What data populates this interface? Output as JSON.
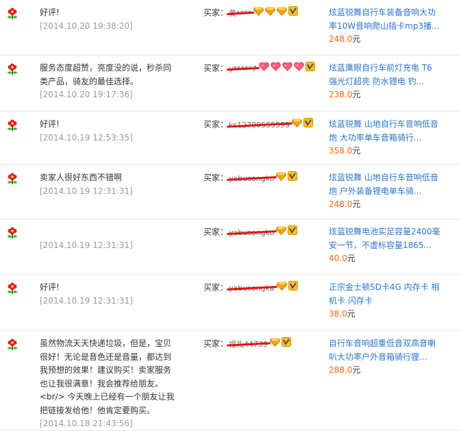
{
  "labels": {
    "buyer": "买家：",
    "currency": "元"
  },
  "reviews": [
    {
      "comment_lines": [
        "好评!"
      ],
      "time": "[2014.10.20 19:38:20]",
      "buyer_name": "黄****",
      "badges": [
        "diamond",
        "diamond",
        "diamond",
        "vip"
      ],
      "product_lines": [
        "炫蓝锐舞自行车装备音响大功",
        "率10W音响爬山插卡mp3播..."
      ],
      "price": "248.0"
    },
    {
      "comment_lines": [
        "服务态度超赞，亮度没的说，秒杀同",
        "类产品，骑友的最佳选择。"
      ],
      "time": "[2014.10.20 19:17:36]",
      "buyer_name": "y*****7",
      "badges": [
        "heart",
        "heart",
        "heart",
        "heart",
        "vip"
      ],
      "product_lines": [
        "炫蓝鹰眼自行车前灯充电 T6",
        "强光灯超亮 防水锂电 钓..."
      ],
      "price": "238.0"
    },
    {
      "comment_lines": [
        "好评!"
      ],
      "time": "[2014.10.19 12:53:35]",
      "buyer_name": "ks12700555599",
      "badges": [
        "diamond",
        "vip"
      ],
      "product_lines": [
        "炫蓝锐舞 山地自行车音响低音",
        "炮 大功率单车音箱骑行..."
      ],
      "price": "358.0"
    },
    {
      "comment_lines": [
        "卖家人很好东西不错啊"
      ],
      "time": "[2014.10.19 12:31:31]",
      "buyer_name": "yabusongko",
      "badges": [
        "diamond",
        "vip"
      ],
      "product_lines": [
        "炫蓝锐舞 山地自行车音响低音",
        "炮 户外装备锂电单车骑..."
      ],
      "price": "248.0"
    },
    {
      "comment_lines": [],
      "time": "[2014.10.19 12:31:31]",
      "buyer_name": "yabusongko",
      "badges": [
        "diamond",
        "vip"
      ],
      "product_lines": [
        "炫蓝锐舞电池实足容量2400毫",
        "安一节，不虚标容量1865..."
      ],
      "price": "40.0"
    },
    {
      "comment_lines": [
        "好评!"
      ],
      "time": "[2014.10.19 12:31:31]",
      "buyer_name": "yabusongka",
      "badges": [
        "diamond",
        "vip"
      ],
      "product_lines": [
        "正宗金士顿SD卡4G 内存卡 相",
        "机卡 闪存卡"
      ],
      "price": "38.0"
    },
    {
      "comment_lines": [
        "虽然物流天天快递垃圾，但是，宝贝",
        "很好！无论是音色还是音量，都达到",
        "我预想的效果！建议购买！卖家服务",
        "也让我很满意！我会推荐给朋友。",
        "<br/> 今天晚上已经有一个朋友让我",
        "把链接发给他！他肯定要购买。"
      ],
      "time": "[2014.10.18 21:43:56]",
      "buyer_name": "福礼44739",
      "badges": [
        "diamond",
        "vip"
      ],
      "product_lines": [
        "自行车音响超重低音双高音喇",
        "叭大功率户外音箱骑行狸..."
      ],
      "price": "288.0"
    }
  ]
}
